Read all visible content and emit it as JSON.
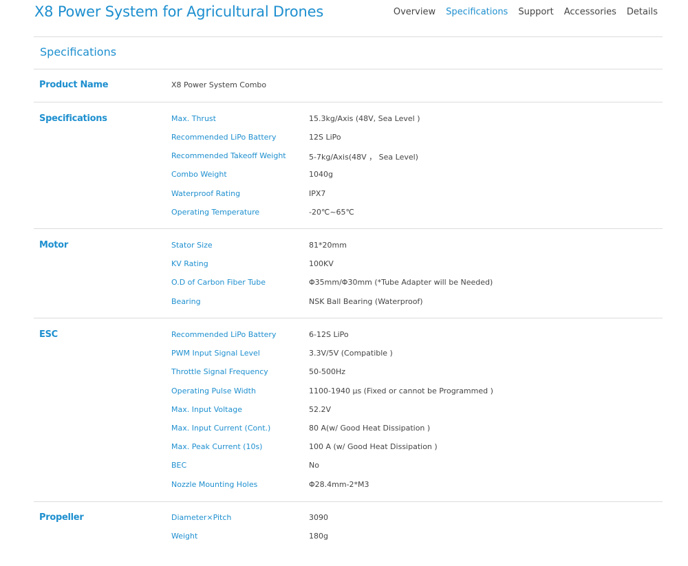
{
  "header": {
    "title": "X8 Power System for Agricultural Drones",
    "nav": [
      "Overview",
      "Specifications",
      "Support",
      "Accessories",
      "Details"
    ],
    "active_nav": "Specifications"
  },
  "section_title": "Specifications",
  "product": {
    "label": "Product Name",
    "value": "X8 Power System Combo"
  },
  "groups": [
    {
      "label": "Specifications",
      "rows": [
        {
          "key": "Max. Thrust",
          "value": "15.3kg/Axis (48V, Sea Level )"
        },
        {
          "key": "Recommended LiPo Battery",
          "value": "12S LiPo"
        },
        {
          "key": "Recommended Takeoff Weight",
          "value": "5-7kg/Axis(48V ， Sea Level)"
        },
        {
          "key": "Combo Weight",
          "value": "1040g"
        },
        {
          "key": "Waterproof Rating",
          "value": "IPX7"
        },
        {
          "key": "Operating Temperature",
          "value": "-20℃~65℃"
        }
      ]
    },
    {
      "label": "Motor",
      "rows": [
        {
          "key": "Stator Size",
          "value": "81*20mm"
        },
        {
          "key": "KV Rating",
          "value": "100KV"
        },
        {
          "key": "O.D of Carbon Fiber Tube",
          "value": "Φ35mm/Φ30mm (*Tube Adapter will be Needed)"
        },
        {
          "key": "Bearing",
          "value": "NSK Ball Bearing (Waterproof)"
        }
      ]
    },
    {
      "label": "ESC",
      "rows": [
        {
          "key": "Recommended LiPo Battery",
          "value": "6-12S LiPo"
        },
        {
          "key": "PWM Input Signal Level",
          "value": "3.3V/5V (Compatible )"
        },
        {
          "key": "Throttle Signal Frequency",
          "value": "50-500Hz"
        },
        {
          "key": "Operating Pulse Width",
          "value": "1100-1940 μs (Fixed or cannot be Programmed )"
        },
        {
          "key": "Max. Input Voltage",
          "value": "52.2V"
        },
        {
          "key": "Max. Input Current (Cont.)",
          "value": "80 A(w/ Good Heat Dissipation )"
        },
        {
          "key": "Max. Peak Current (10s)",
          "value": "100 A (w/ Good Heat Dissipation )"
        },
        {
          "key": "BEC",
          "value": "No"
        },
        {
          "key": "Nozzle Mounting Holes",
          "value": "Φ28.4mm-2*M3"
        }
      ]
    },
    {
      "label": "Propeller",
      "rows": [
        {
          "key": "Diameter×Pitch",
          "value": "3090"
        },
        {
          "key": "Weight",
          "value": "180g"
        }
      ]
    }
  ]
}
